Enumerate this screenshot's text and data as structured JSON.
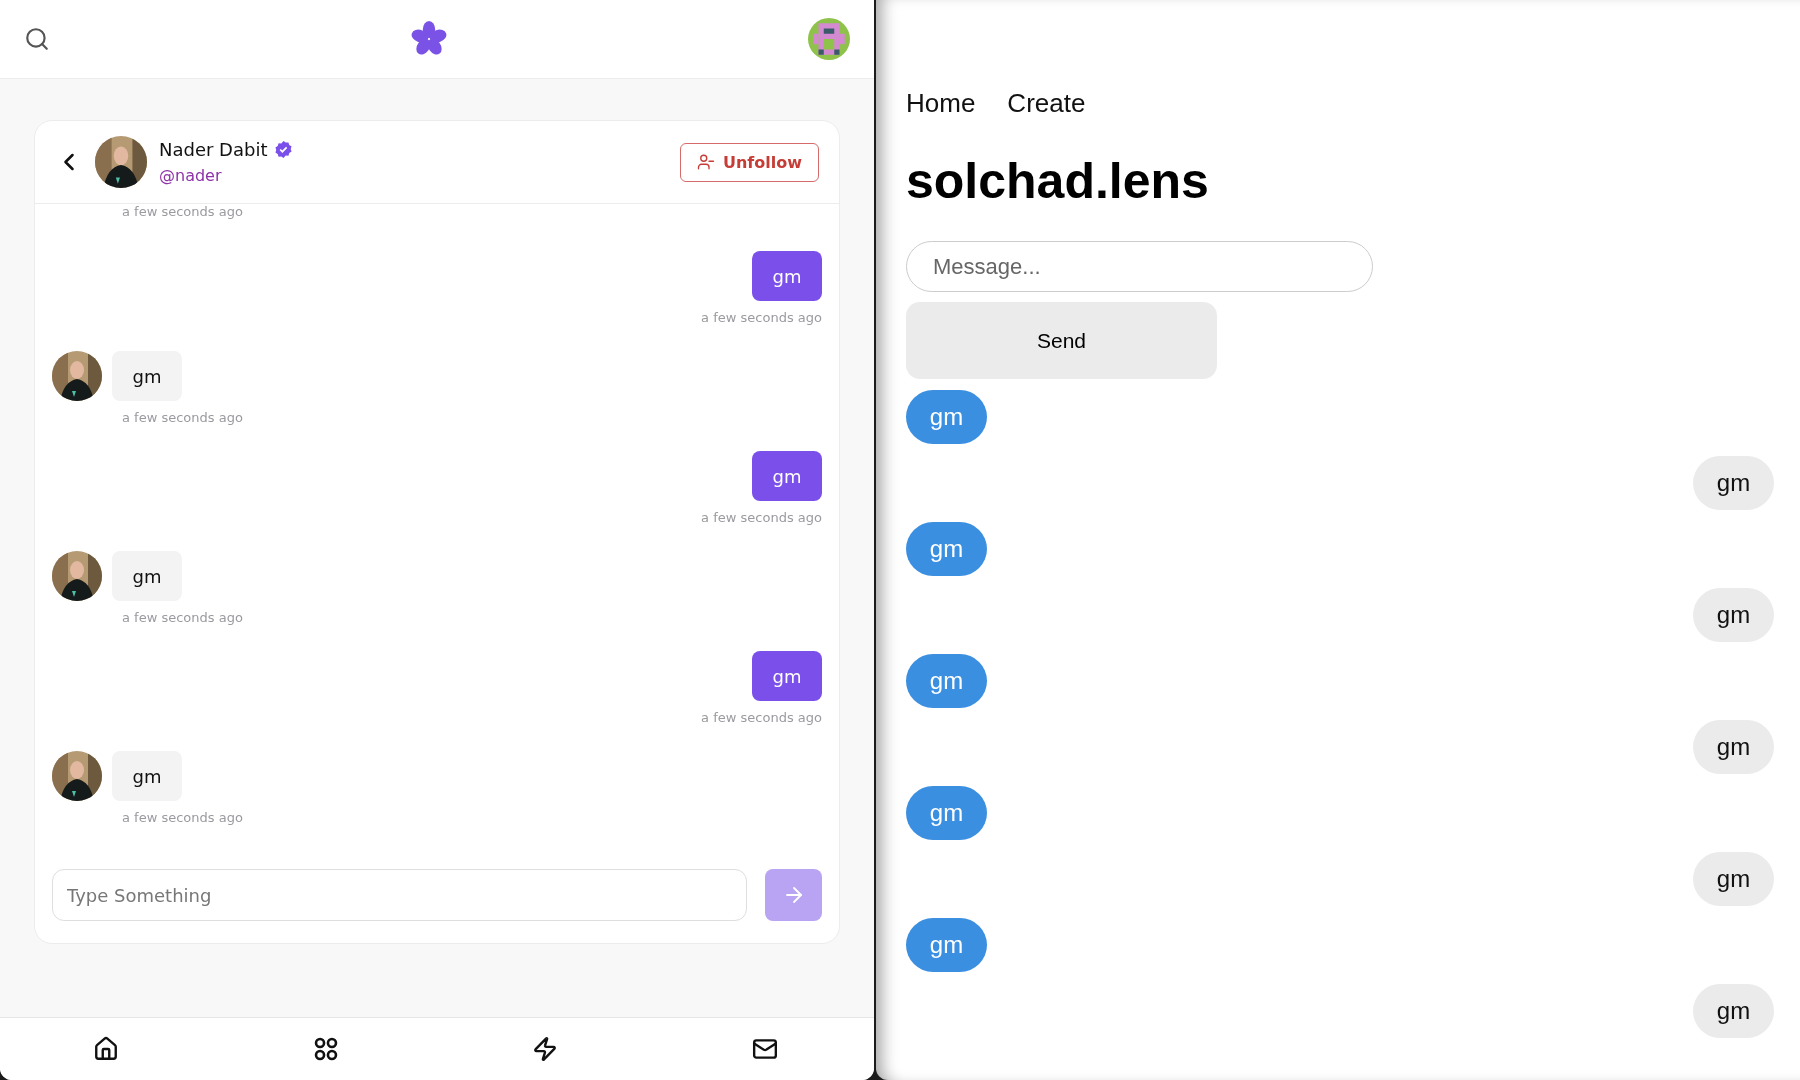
{
  "chat": {
    "contact": {
      "name": "Nader Dabit",
      "handle": "@nader",
      "verified": true
    },
    "follow_button": "Unfollow",
    "earlier_timestamp": "a few seconds ago",
    "messages": [
      {
        "kind": "sent",
        "text": "gm",
        "time": "a few seconds ago"
      },
      {
        "kind": "received",
        "text": "gm",
        "time": "a few seconds ago"
      },
      {
        "kind": "sent",
        "text": "gm",
        "time": "a few seconds ago"
      },
      {
        "kind": "received",
        "text": "gm",
        "time": "a few seconds ago"
      },
      {
        "kind": "sent",
        "text": "gm",
        "time": "a few seconds ago"
      },
      {
        "kind": "received",
        "text": "gm",
        "time": "a few seconds ago"
      }
    ],
    "composer": {
      "placeholder": "Type Something",
      "send_disabled": true
    }
  },
  "right": {
    "nav": [
      "Home",
      "Create"
    ],
    "title": "solchad.lens",
    "message_field": {
      "placeholder": "Message..."
    },
    "send_button": "Send",
    "messages": [
      {
        "kind": "received",
        "text": "gm"
      },
      {
        "kind": "sent",
        "text": "gm"
      },
      {
        "kind": "received",
        "text": "gm"
      },
      {
        "kind": "sent",
        "text": "gm"
      },
      {
        "kind": "received",
        "text": "gm"
      },
      {
        "kind": "sent",
        "text": "gm"
      },
      {
        "kind": "received",
        "text": "gm"
      },
      {
        "kind": "sent",
        "text": "gm"
      },
      {
        "kind": "received",
        "text": "gm"
      },
      {
        "kind": "sent",
        "text": "gm"
      }
    ]
  }
}
